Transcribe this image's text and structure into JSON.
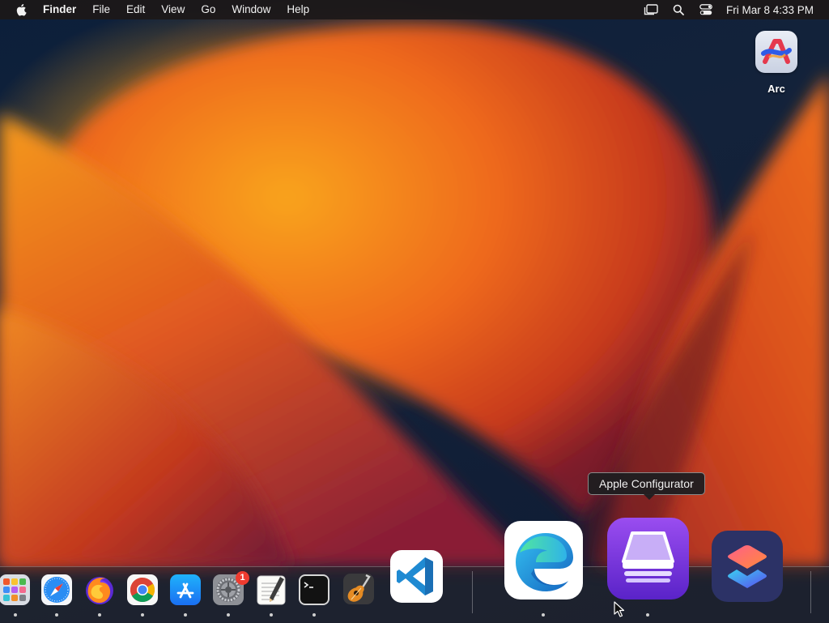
{
  "menubar": {
    "app_name": "Finder",
    "menus": [
      "File",
      "Edit",
      "View",
      "Go",
      "Window",
      "Help"
    ],
    "clock": "Fri Mar 8  4:33 PM"
  },
  "desktop": {
    "icons": [
      {
        "label": "Arc",
        "icon": "arc-browser-icon"
      }
    ]
  },
  "tooltip": {
    "text": "Apple Configurator"
  },
  "dock": {
    "apps": [
      {
        "name": "Launchpad",
        "icon": "launchpad-icon",
        "running": true
      },
      {
        "name": "Safari",
        "icon": "safari-icon",
        "running": true
      },
      {
        "name": "Firefox",
        "icon": "firefox-icon",
        "running": true
      },
      {
        "name": "Google Chrome",
        "icon": "chrome-icon",
        "running": true
      },
      {
        "name": "App Store",
        "icon": "app-store-icon",
        "running": true
      },
      {
        "name": "System Settings",
        "icon": "system-settings-icon",
        "running": true,
        "badge": "1"
      },
      {
        "name": "TextEdit",
        "icon": "textedit-icon",
        "running": true
      },
      {
        "name": "Terminal",
        "icon": "terminal-icon",
        "running": true
      },
      {
        "name": "GarageBand",
        "icon": "garageband-icon",
        "running": false
      },
      {
        "name": "Visual Studio Code",
        "icon": "vscode-icon",
        "running": false
      },
      {
        "name": "Microsoft Edge",
        "icon": "edge-icon",
        "running": true
      },
      {
        "name": "Apple Configurator",
        "icon": "apple-configurator-icon",
        "running": true
      },
      {
        "name": "Shortcuts",
        "icon": "shortcuts-icon",
        "running": false
      }
    ]
  },
  "colors": {
    "wallpaper_orange": "#f07a1e",
    "wallpaper_navy": "#0f1b33",
    "badge_red": "#ee3b2f"
  }
}
